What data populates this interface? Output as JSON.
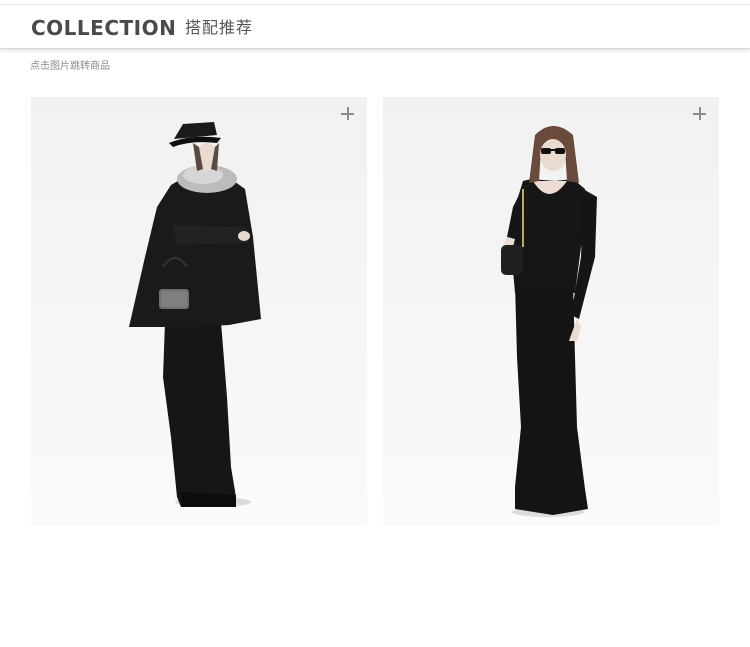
{
  "header": {
    "title": "COLLECTION",
    "subtitle": "搭配推荐"
  },
  "hint": "点击图片跳转商品",
  "products": [
    {
      "name": "look-1",
      "description_icon": "plus-icon",
      "photo_subject": "model in black cape coat with fur collar, hat and long black skirt"
    },
    {
      "name": "look-2",
      "description_icon": "plus-icon",
      "photo_subject": "model in black knit top and long black mermaid skirt"
    }
  ],
  "colors": {
    "header_text": "#4a4a4a",
    "hint_text": "#8a8a8a",
    "plus_icon": "#8d8d8d",
    "photo_background": "#f3f3f3",
    "garment": "#151515"
  }
}
